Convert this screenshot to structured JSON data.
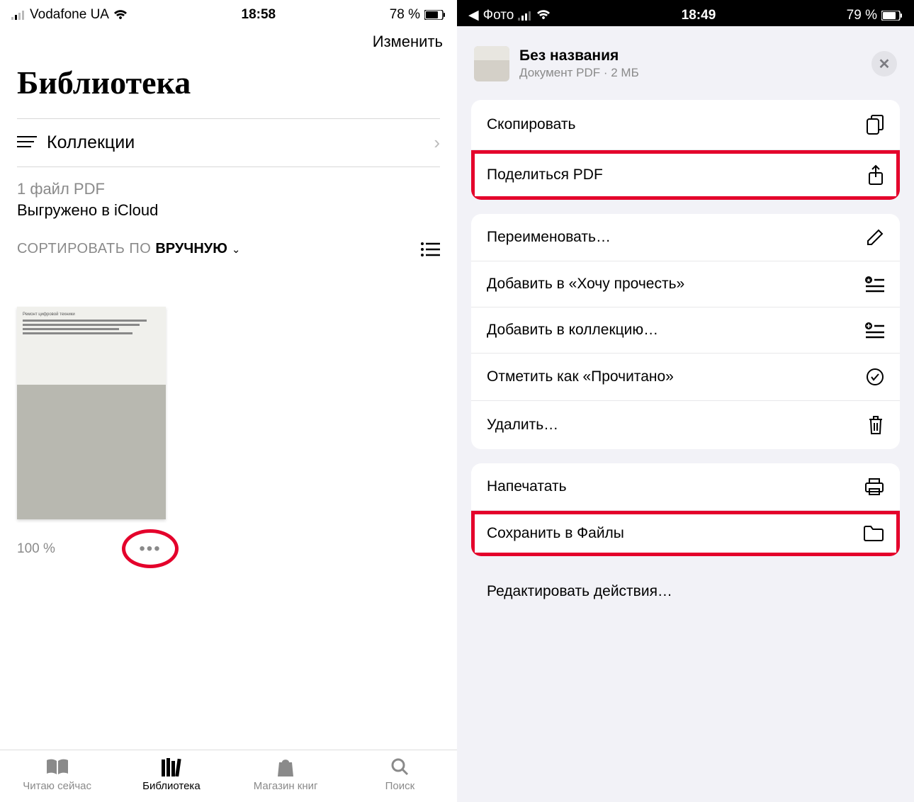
{
  "left": {
    "status": {
      "carrier": "Vodafone UA",
      "time": "18:58",
      "battery": "78 %"
    },
    "nav": {
      "edit": "Изменить"
    },
    "title": "Библиотека",
    "collections_label": "Коллекции",
    "file_count": "1 файл PDF",
    "uploaded": "Выгружено в iCloud",
    "sort_label": "СОРТИРОВАТЬ ПО",
    "sort_value": "ВРУЧНУЮ",
    "progress": "100 %",
    "tabs": [
      {
        "label": "Читаю сейчас"
      },
      {
        "label": "Библиотека"
      },
      {
        "label": "Магазин книг"
      },
      {
        "label": "Поиск"
      }
    ]
  },
  "right": {
    "status": {
      "back": "Фото",
      "time": "18:49",
      "battery": "79 %"
    },
    "doc_title": "Без названия",
    "doc_meta": "Документ PDF · 2 МБ",
    "actions": {
      "copy": "Скопировать",
      "share": "Поделиться PDF",
      "rename": "Переименовать…",
      "want_read": "Добавить в «Хочу прочесть»",
      "add_coll": "Добавить в коллекцию…",
      "mark_read": "Отметить как «Прочитано»",
      "delete": "Удалить…",
      "print": "Напечатать",
      "save_files": "Сохранить в Файлы"
    },
    "edit_actions": "Редактировать действия…"
  }
}
